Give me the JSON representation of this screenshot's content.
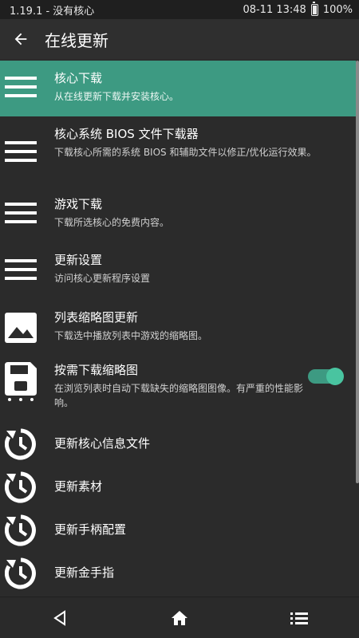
{
  "status_bar": {
    "left_text": "1.19.1 - 没有核心",
    "time": "08-11 13:48",
    "battery": "100%"
  },
  "app_bar": {
    "title": "在线更新",
    "back_icon": "arrow-left-icon"
  },
  "accent_color": "#3d9a82",
  "items": [
    {
      "title": "核心下载",
      "desc": "从在线更新下载并安装核心。",
      "icon": "menu-lines-icon",
      "active": true
    },
    {
      "title": "核心系统 BIOS 文件下载器",
      "desc": "下载核心所需的系统 BIOS 和辅助文件以修正/优化运行效果。",
      "icon": "menu-lines-icon"
    },
    {
      "title": "游戏下载",
      "desc": "下载所选核心的免费内容。",
      "icon": "menu-lines-icon"
    },
    {
      "title": "更新设置",
      "desc": "访问核心更新程序设置",
      "icon": "menu-lines-icon"
    },
    {
      "title": "列表缩略图更新",
      "desc": "下载选中播放列表中游戏的缩略图。",
      "icon": "image-icon"
    },
    {
      "title": "按需下载缩略图",
      "desc": "在浏览列表时自动下载缺失的缩略图图像。有严重的性能影响。",
      "icon": "floppy-disk-icon",
      "toggle": true
    },
    {
      "title": "更新核心信息文件",
      "icon": "update-clock-icon"
    },
    {
      "title": "更新素材",
      "icon": "update-clock-icon"
    },
    {
      "title": "更新手柄配置",
      "icon": "update-clock-icon"
    },
    {
      "title": "更新金手指",
      "icon": "update-clock-icon"
    }
  ],
  "nav_bar": {
    "icons": [
      "back-triangle-icon",
      "home-icon",
      "list-icon"
    ]
  }
}
